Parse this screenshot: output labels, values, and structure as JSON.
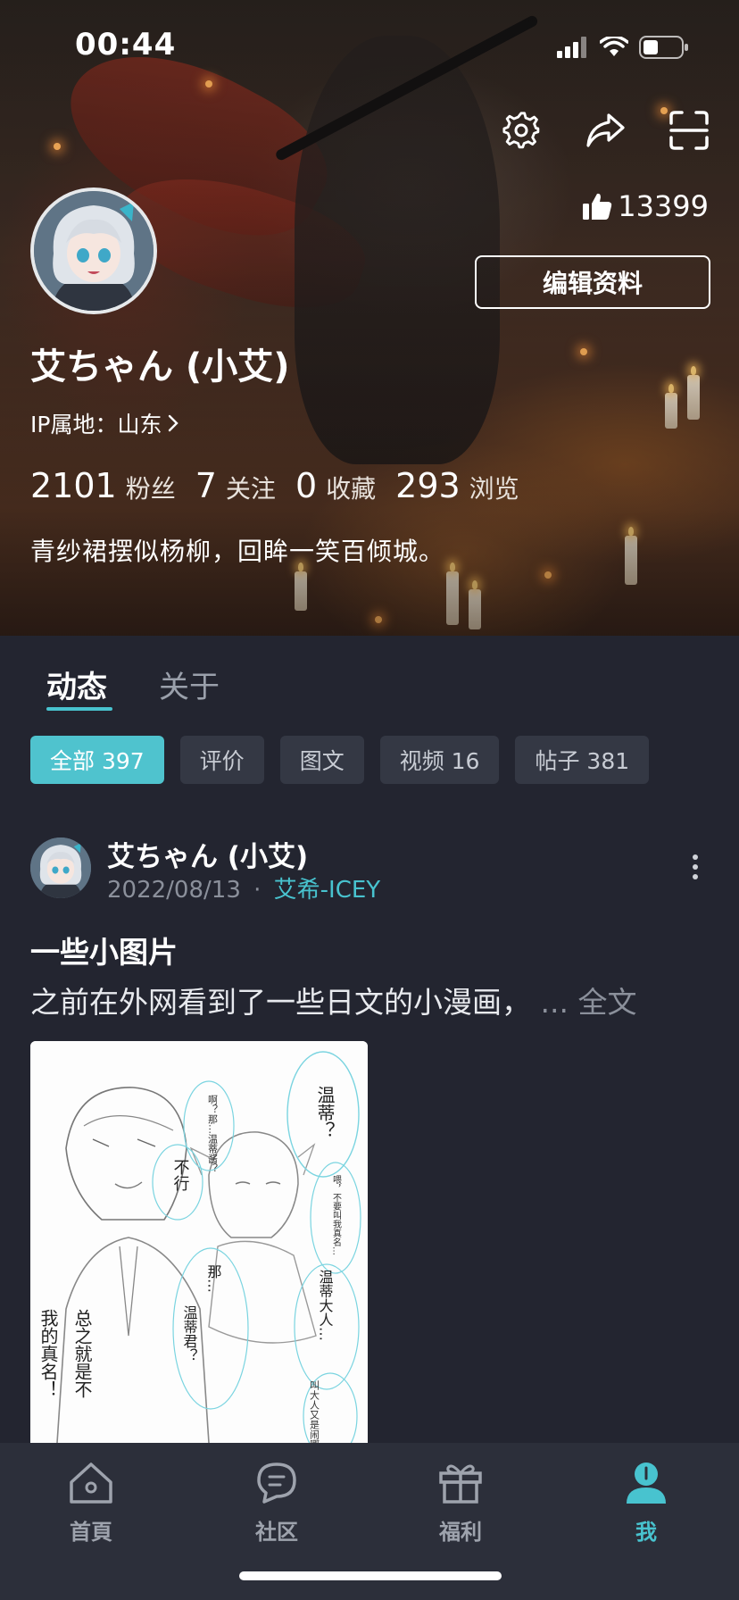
{
  "status_bar": {
    "time": "00:44"
  },
  "profile": {
    "likes": "13399",
    "edit_label": "编辑资料",
    "username": "艾ちゃん (小艾)",
    "ip_location": "IP属地：山东",
    "stats": [
      {
        "value": "2101",
        "label": "粉丝"
      },
      {
        "value": "7",
        "label": "关注"
      },
      {
        "value": "0",
        "label": "收藏"
      },
      {
        "value": "293",
        "label": "浏览"
      }
    ],
    "bio": "青纱裙摆似杨柳，回眸一笑百倾城。"
  },
  "tabs": [
    {
      "label": "动态",
      "active": true
    },
    {
      "label": "关于",
      "active": false
    }
  ],
  "filters": [
    {
      "label": "全部 397",
      "active": true
    },
    {
      "label": "评价",
      "active": false
    },
    {
      "label": "图文",
      "active": false
    },
    {
      "label": "视频 16",
      "active": false
    },
    {
      "label": "帖子 381",
      "active": false
    }
  ],
  "post": {
    "author": "艾ちゃん (小艾)",
    "date": "2022/08/13",
    "separator": "·",
    "game": "艾希-ICEY",
    "title": "一些小图片",
    "excerpt": "之前在外网看到了一些日文的小漫画，",
    "ellipsis": "...",
    "full_text": "全文",
    "image_texts": {
      "t1": "温蒂？",
      "t2": "啊？那…温蒂酱？",
      "t3": "不行",
      "t4": "喂，不要叫我真名…",
      "t5": "那…",
      "t6": "温蒂君？",
      "t7": "温蒂大人…",
      "t8": "叫大人又是闹哪出啊？",
      "t9": "总之就是不",
      "t10": "我的真名！"
    }
  },
  "bottom_nav": [
    {
      "label": "首頁",
      "icon": "home-icon",
      "active": false
    },
    {
      "label": "社区",
      "icon": "community-icon",
      "active": false
    },
    {
      "label": "福利",
      "icon": "gift-icon",
      "active": false
    },
    {
      "label": "我",
      "icon": "profile-icon",
      "active": true
    }
  ],
  "colors": {
    "accent": "#48c3cf",
    "background": "#232530",
    "nav_background": "#2c2f3a"
  }
}
